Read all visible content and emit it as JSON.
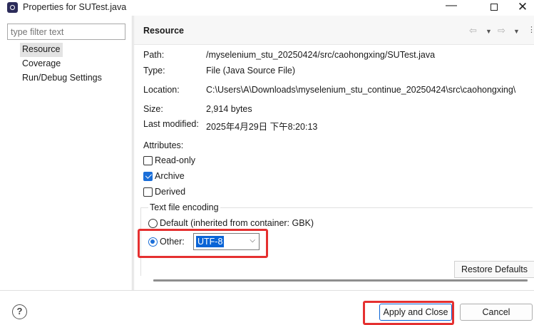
{
  "window": {
    "title": "Properties for SUTest.java"
  },
  "left": {
    "filter_placeholder": "type filter text",
    "tree": [
      "Resource",
      "Coverage",
      "Run/Debug Settings"
    ],
    "selected": "Resource"
  },
  "page": {
    "title": "Resource",
    "fields": [
      {
        "label": "Path:",
        "value": "/myselenium_stu_20250424/src/caohongxing/SUTest.java"
      },
      {
        "label": "Type:",
        "value": "File  (Java Source File)"
      },
      {
        "label": "Location:",
        "value": "C:\\Users\\A\\Downloads\\myselenium_stu_continue_20250424\\src\\caohongxing\\"
      },
      {
        "label": "Size:",
        "value": "2,914  bytes"
      },
      {
        "label": "Last modified:",
        "value": "2025年4月29日 下午8:20:13"
      }
    ],
    "attributes_label": "Attributes:",
    "attributes": [
      {
        "label": "Read-only",
        "checked": false
      },
      {
        "label": "Archive",
        "checked": true
      },
      {
        "label": "Derived",
        "checked": false
      }
    ],
    "encoding": {
      "group_title": "Text file encoding",
      "default_label": "Default (inherited from container: GBK)",
      "other_label": "Other:",
      "selected_option": "other",
      "other_value": "UTF-8"
    },
    "restore_defaults_label": "Restore Defaults"
  },
  "buttons": {
    "apply_close": "Apply and Close",
    "cancel": "Cancel",
    "help": "?"
  },
  "colors": {
    "accent": "#1a6ed8",
    "highlight": "#e53030",
    "selection": "#0a64d6"
  }
}
